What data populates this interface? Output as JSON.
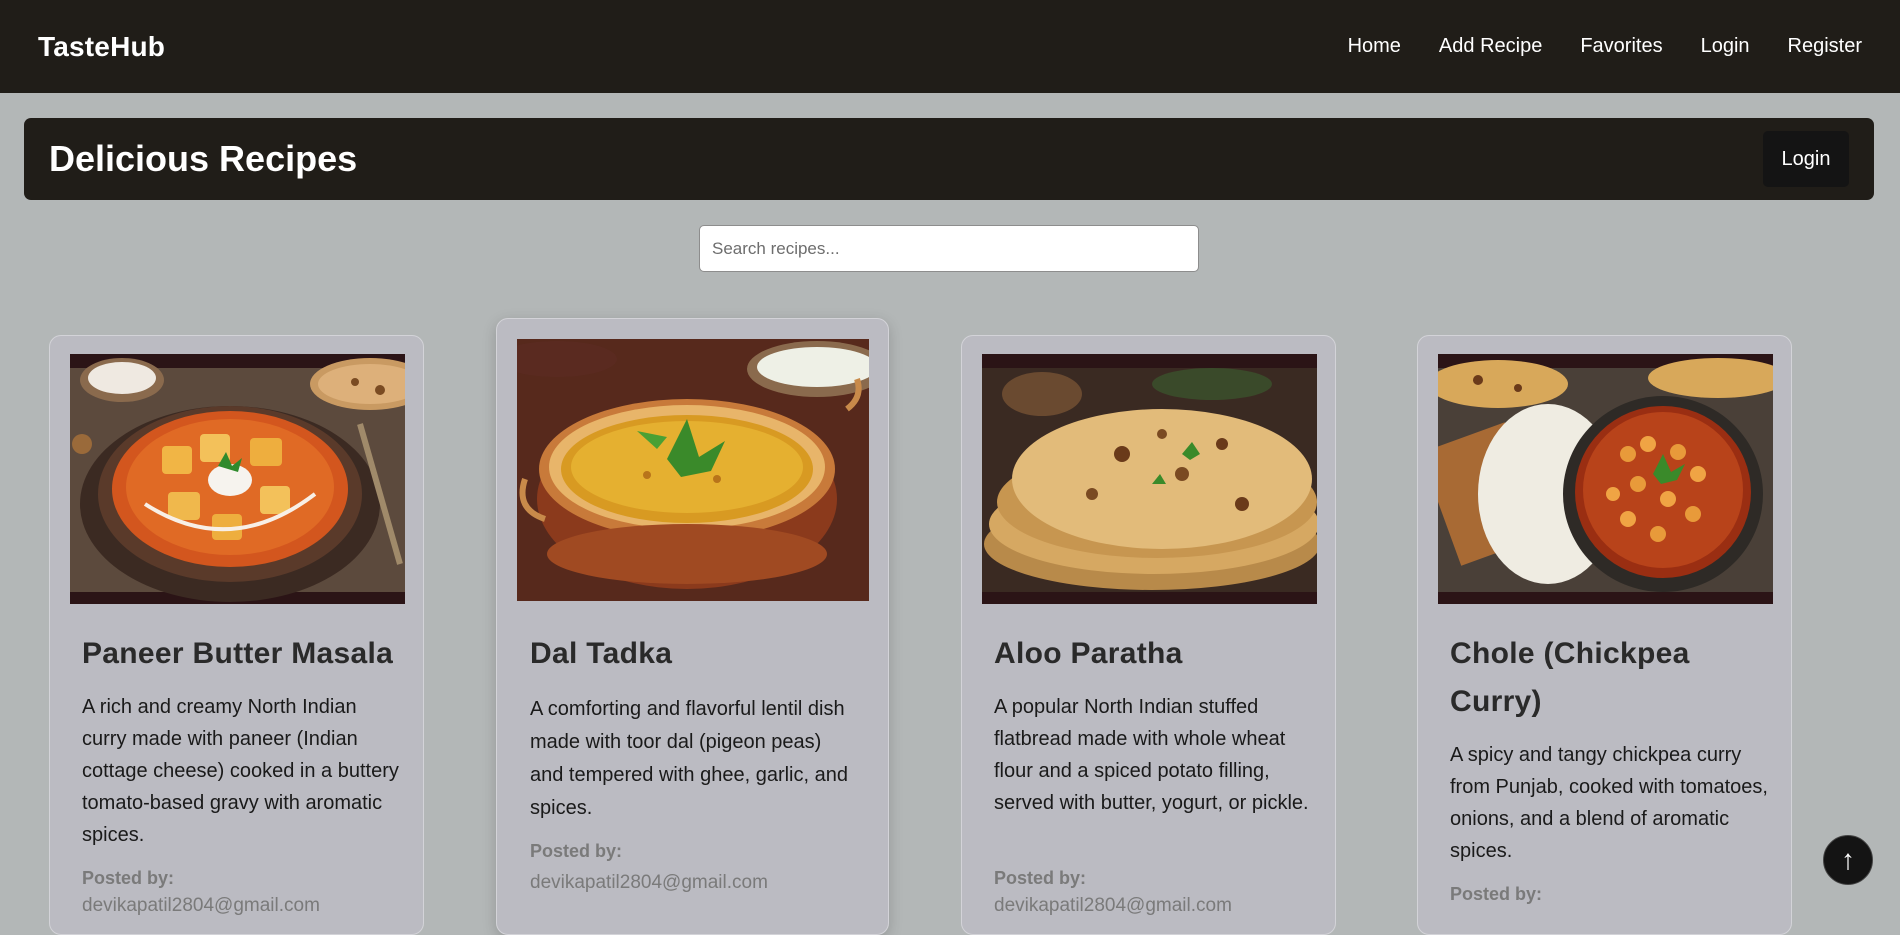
{
  "navbar": {
    "brand": "TasteHub",
    "links": [
      "Home",
      "Add Recipe",
      "Favorites",
      "Login",
      "Register"
    ]
  },
  "banner": {
    "title": "Delicious Recipes",
    "login_label": "Login"
  },
  "search": {
    "placeholder": "Search recipes..."
  },
  "recipes": [
    {
      "title": "Paneer Butter Masala",
      "description": "A rich and creamy North Indian curry made with paneer (Indian cottage cheese) cooked in a buttery tomato-based gravy with aromatic spices.",
      "posted_by_label": "Posted by:",
      "posted_by": "devikapatil2804@gmail.com"
    },
    {
      "title": "Dal Tadka",
      "description": "A comforting and flavorful lentil dish made with toor dal (pigeon peas) and tempered with ghee, garlic, and spices.",
      "posted_by_label": "Posted by:",
      "posted_by": "devikapatil2804@gmail.com"
    },
    {
      "title": "Aloo Paratha",
      "description": "A popular North Indian stuffed flatbread made with whole wheat flour and a spiced potato filling, served with butter, yogurt, or pickle.",
      "posted_by_label": "Posted by:",
      "posted_by": "devikapatil2804@gmail.com"
    },
    {
      "title": "Chole (Chickpea Curry)",
      "description": "A spicy and tangy chickpea curry from Punjab, cooked with tomatoes, onions, and a blend of aromatic spices.",
      "posted_by_label": "Posted by:",
      "posted_by": ""
    }
  ],
  "scroll_top": {
    "icon": "↑"
  },
  "colors": {
    "navbar_bg": "#201d18",
    "page_bg": "#b3b7b7",
    "card_bg": "#bbbbc2"
  }
}
